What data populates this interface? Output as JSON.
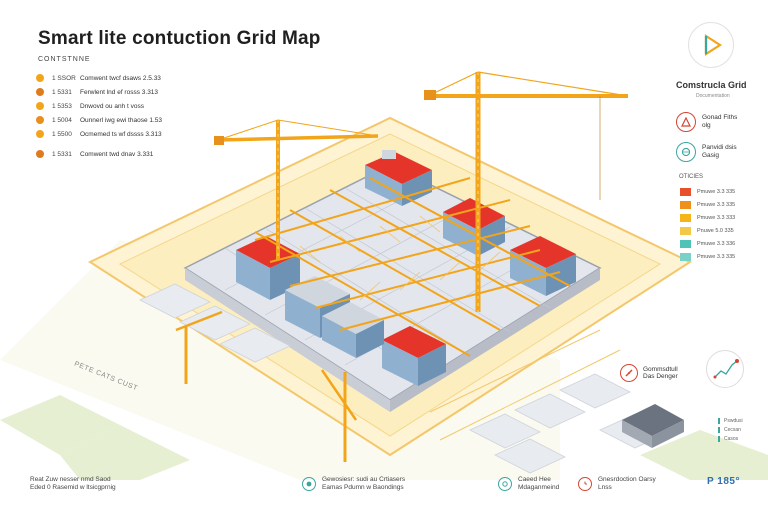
{
  "header": {
    "title": "Smart lite contuction Grid Map"
  },
  "legend": {
    "heading": "CONTSTNNE",
    "items": [
      {
        "code": "1 SSOR",
        "text": "Comwent twcf dsaws 2.5.33",
        "color": "#f2a51a"
      },
      {
        "code": "1 5331",
        "text": "Ferwlent lnd ef rosss 3.313",
        "color": "#e07b1c"
      },
      {
        "code": "1 5353",
        "text": "Dnwovd ou anh t voss",
        "color": "#f2a51a"
      },
      {
        "code": "1 5004",
        "text": "Ounnerl iwg ewi thaose 1.53",
        "color": "#e8901c"
      },
      {
        "code": "1 5500",
        "text": "Ocmemed ts wf dssss 3.313",
        "color": "#f2a51a"
      },
      {
        "code": "1 5331",
        "text": "Comwent twd dnav 3.331",
        "color": "#e07b1c"
      }
    ]
  },
  "panel": {
    "title": "Comstrucla Grid",
    "subtitle": "Documentation",
    "status": [
      {
        "line1": "Gonad Fiths",
        "line2": "olg",
        "icon": "warning-icon",
        "color": "#d64533"
      },
      {
        "line1": "Panvidi dsis",
        "line2": "Gasig",
        "icon": "globe-icon",
        "color": "#3aa6a0"
      }
    ],
    "scale_heading": "OTICIES",
    "scale": [
      {
        "label": "Pmuwe 3.3 335",
        "color": "#e8502a"
      },
      {
        "label": "Pmuwe 3.3 335",
        "color": "#f0901c"
      },
      {
        "label": "Pmuwe 3.3 333",
        "color": "#f5b51a"
      },
      {
        "label": "Pnuwe 5.0 335",
        "color": "#f3c94a"
      },
      {
        "label": "Pmuwe 3.3 336",
        "color": "#4fc3b8"
      },
      {
        "label": "Pmuwe 3.3 335",
        "color": "#7ad1c6"
      }
    ]
  },
  "side": {
    "badge_line1": "Gommsdtull",
    "badge_line2": "Das Denger",
    "mini_legend": [
      "Pswdusi",
      "Cecsan",
      "Casos"
    ]
  },
  "map": {
    "street_label": "PETE CATS CUST"
  },
  "footer": {
    "items": [
      {
        "line1": "Reat Zuw nesser nmd Saod",
        "line2": "Eded 0 Rasemid w ltsicgprnig"
      },
      {
        "line1": "Gewosiesr: sudi au Crtiasers",
        "line2": "Eamas Pdumn w Baondings"
      },
      {
        "line1": "Caeed Hee",
        "line2": "Mdaganmeind"
      },
      {
        "line1": "Gnesrdoction Oarsy",
        "line2": "Lnss"
      }
    ],
    "percent": "P 185°"
  },
  "colors": {
    "crane": "#f2a51a",
    "roof": "#e5352a",
    "building": "#7fa7c8",
    "site": "#fde9b0"
  }
}
